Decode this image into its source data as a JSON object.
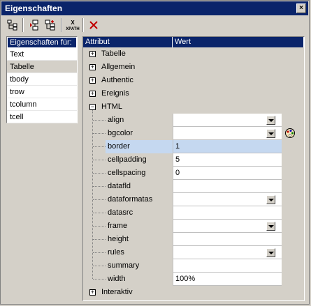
{
  "window": {
    "title": "Eigenschaften",
    "close_glyph": "×"
  },
  "toolbar": {
    "buttons": [
      {
        "icon": "tree-structure-icon"
      },
      {
        "icon": "insert-element-icon"
      },
      {
        "icon": "add-element-icon"
      },
      {
        "icon": "xpath-icon",
        "label": "XPATH"
      },
      {
        "icon": "delete-icon"
      }
    ]
  },
  "left_panel": {
    "header": "Eigenschaften für:",
    "items": [
      "Text",
      "Tabelle",
      "tbody",
      "trow",
      "tcolumn",
      "tcell"
    ],
    "selected": "Tabelle"
  },
  "grid": {
    "headers": {
      "attribute": "Attribut",
      "value": "Wert"
    },
    "groups": [
      {
        "label": "Tabelle",
        "expander": "+"
      },
      {
        "label": "Allgemein",
        "expander": "+"
      },
      {
        "label": "Authentic",
        "expander": "+"
      },
      {
        "label": "Ereignis",
        "expander": "+"
      },
      {
        "label": "HTML",
        "expander": "−"
      }
    ],
    "html_attributes": [
      {
        "name": "align",
        "value": "",
        "dropdown": true
      },
      {
        "name": "bgcolor",
        "value": "",
        "dropdown": true,
        "palette": true
      },
      {
        "name": "border",
        "value": "1",
        "selected": true
      },
      {
        "name": "cellpadding",
        "value": "5"
      },
      {
        "name": "cellspacing",
        "value": "0"
      },
      {
        "name": "datafld",
        "value": ""
      },
      {
        "name": "dataformatas",
        "value": "",
        "dropdown": true
      },
      {
        "name": "datasrc",
        "value": ""
      },
      {
        "name": "frame",
        "value": "",
        "dropdown": true
      },
      {
        "name": "height",
        "value": ""
      },
      {
        "name": "rules",
        "value": "",
        "dropdown": true
      },
      {
        "name": "summary",
        "value": ""
      },
      {
        "name": "width",
        "value": "100%"
      }
    ],
    "last_group": {
      "label": "Interaktiv",
      "expander": "+"
    }
  }
}
